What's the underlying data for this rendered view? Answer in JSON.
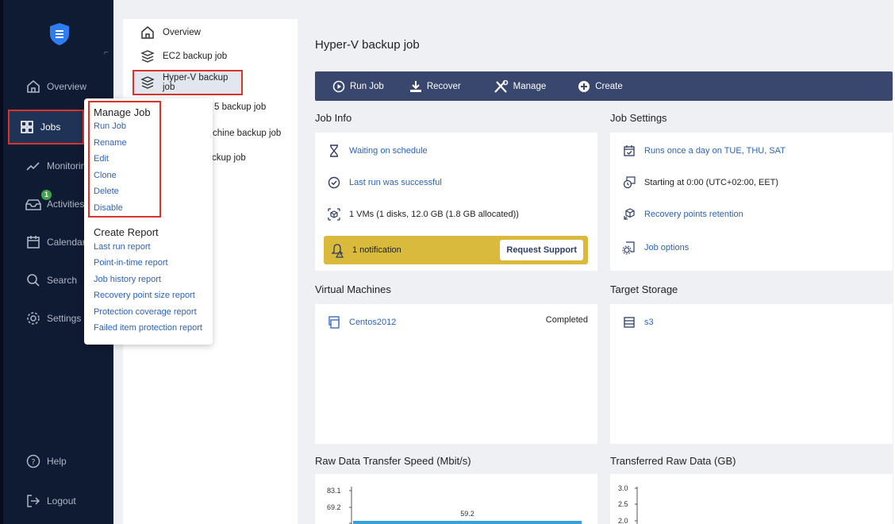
{
  "sidebar": {
    "items": [
      {
        "label": "Overview",
        "icon": "home-icon"
      },
      {
        "label": "Jobs",
        "icon": "grid-icon"
      },
      {
        "label": "Monitoring",
        "icon": "chart-line-icon"
      },
      {
        "label": "Activities",
        "icon": "inbox-icon",
        "badge": "1"
      },
      {
        "label": "Calendar",
        "icon": "calendar-icon"
      },
      {
        "label": "Search",
        "icon": "search-icon"
      },
      {
        "label": "Settings",
        "icon": "gear-icon"
      },
      {
        "label": "Help",
        "icon": "help-icon"
      },
      {
        "label": "Logout",
        "icon": "logout-icon"
      }
    ]
  },
  "joblist": {
    "items": [
      {
        "label": "Overview"
      },
      {
        "label": "EC2 backup job"
      },
      {
        "label": "Hyper-V backup job"
      },
      {
        "label": "5 backup job"
      },
      {
        "label": "chine backup job"
      },
      {
        "label": "ckup job"
      }
    ]
  },
  "popup": {
    "manage_title": "Manage Job",
    "manage_items": [
      "Run Job",
      "Rename",
      "Edit",
      "Clone",
      "Delete",
      "Disable"
    ],
    "report_title": "Create Report",
    "report_items": [
      "Last run report",
      "Point-in-time report",
      "Job history report",
      "Recovery point size report",
      "Protection coverage report",
      "Failed item protection report"
    ]
  },
  "main": {
    "title": "Hyper-V backup job",
    "toolbar": {
      "run": "Run Job",
      "recover": "Recover",
      "manage": "Manage",
      "create": "Create"
    },
    "job_info": {
      "title": "Job Info",
      "status": "Waiting on schedule",
      "last_run": "Last run was successful",
      "vms": "1 VMs (1 disks, 12.0 GB (1.8 GB allocated))",
      "notification": "1 notification",
      "request_support": "Request Support"
    },
    "job_settings": {
      "title": "Job Settings",
      "schedule": "Runs once a day on TUE, THU, SAT",
      "start": "Starting at 0:00 (UTC+02:00, EET)",
      "retention": "Recovery points retention",
      "options": "Job options"
    },
    "vms": {
      "title": "Virtual Machines",
      "name": "Centos2012",
      "status": "Completed"
    },
    "storage": {
      "title": "Target Storage",
      "name": "s3"
    },
    "speed_chart": {
      "title": "Raw Data Transfer Speed (Mbit/s)"
    },
    "data_chart": {
      "title": "Transferred Raw Data (GB)"
    }
  },
  "chart_data": [
    {
      "type": "bar",
      "title": "Raw Data Transfer Speed (Mbit/s)",
      "yticks": [
        "83.1",
        "69.2"
      ],
      "values": [
        59.2
      ],
      "data_labels": [
        "59.2"
      ],
      "bar_color": "#3aa0d8"
    },
    {
      "type": "bar",
      "title": "Transferred Raw Data (GB)",
      "yticks": [
        "3.0",
        "2.5",
        "2.0"
      ],
      "values": []
    }
  ],
  "colors": {
    "accent": "#2d63b7",
    "sidebar": "#0f1a33",
    "toolbar": "#39466e",
    "notification": "#d9ba3c",
    "highlight": "#d9332b"
  }
}
